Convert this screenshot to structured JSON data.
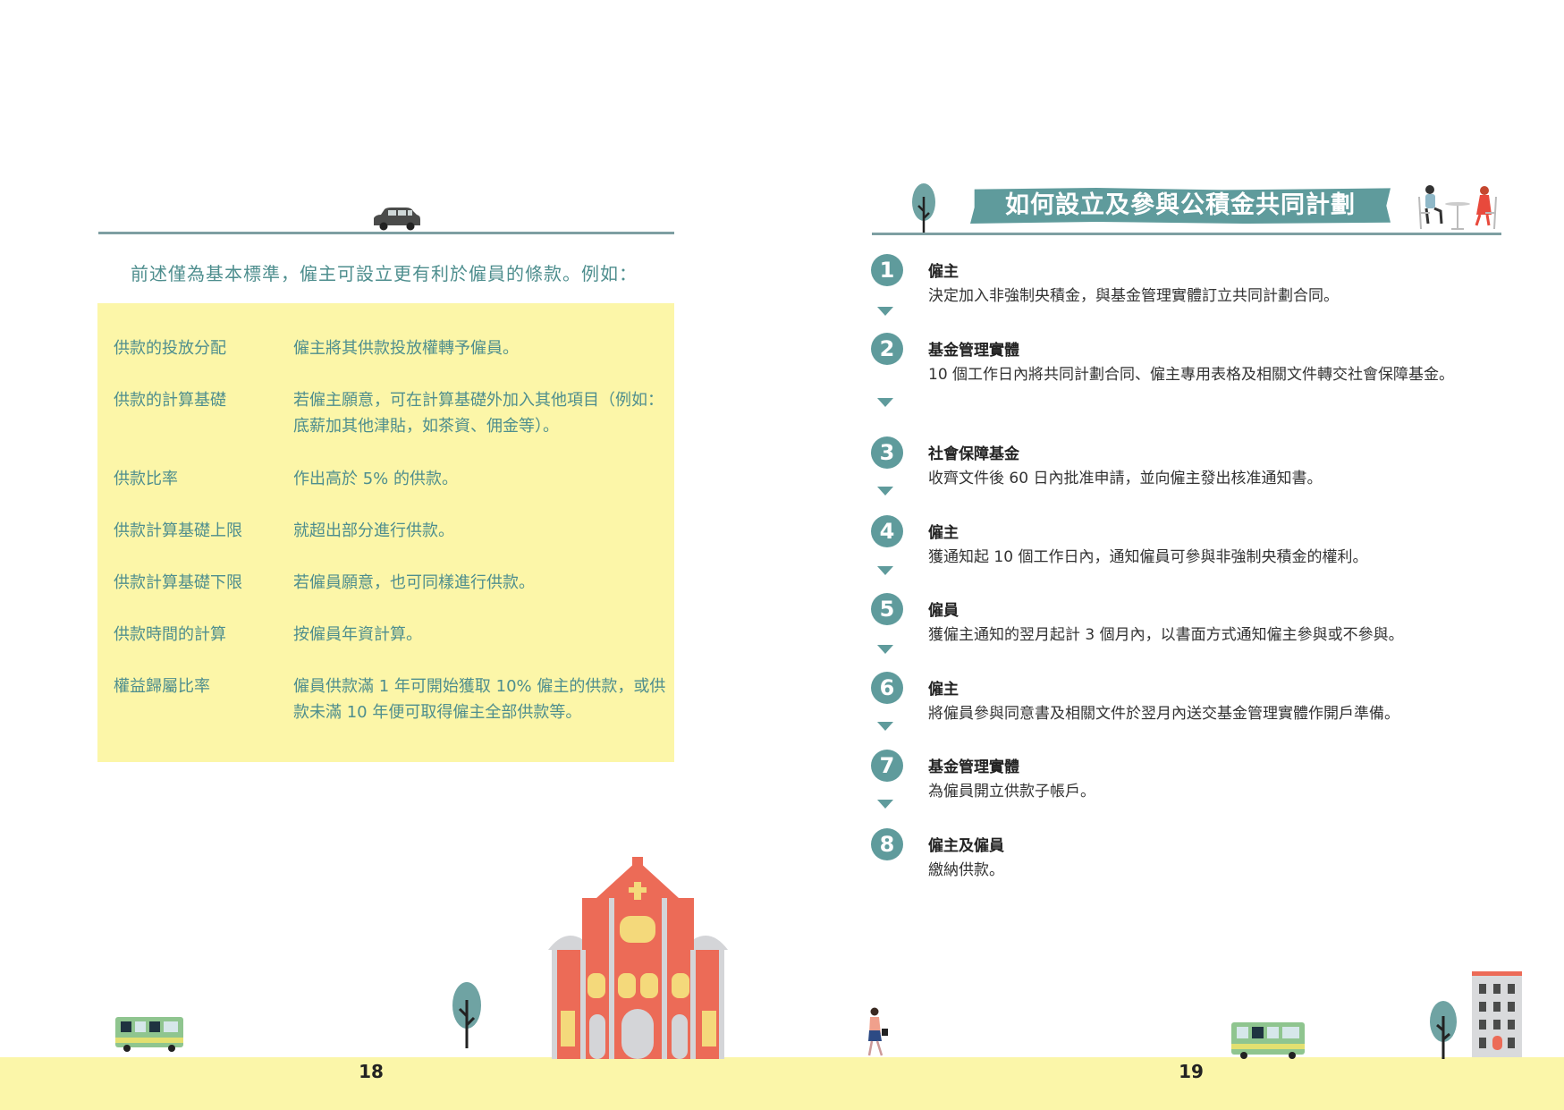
{
  "left_page": {
    "intro": "前述僅為基本標準，僱主可設立更有利於僱員的條款。例如：",
    "rows": [
      {
        "label": "供款的投放分配",
        "value": "僱主將其供款投放權轉予僱員。"
      },
      {
        "label": "供款的計算基礎",
        "value": "若僱主願意，可在計算基礎外加入其他項目（例如：底薪加其他津貼，如茶資、佣金等）。"
      },
      {
        "label": "供款比率",
        "value": "作出高於 5% 的供款。"
      },
      {
        "label": "供款計算基礎上限",
        "value": "就超出部分進行供款。"
      },
      {
        "label": "供款計算基礎下限",
        "value": "若僱員願意，也可同樣進行供款。"
      },
      {
        "label": "供款時間的計算",
        "value": "按僱員年資計算。"
      },
      {
        "label": "權益歸屬比率",
        "value": "僱員供款滿 1 年可開始獲取 10% 僱主的供款，或供款未滿 10 年便可取得僱主全部供款等。"
      }
    ],
    "page_number": "18"
  },
  "right_page": {
    "title": "如何設立及參與公積金共同計劃",
    "steps": [
      {
        "num": "1",
        "title": "僱主",
        "desc": "決定加入非強制央積金，與基金管理實體訂立共同計劃合同。"
      },
      {
        "num": "2",
        "title": "基金管理實體",
        "desc": "10 個工作日內將共同計劃合同、僱主專用表格及相關文件轉交社會保障基金。"
      },
      {
        "num": "3",
        "title": "社會保障基金",
        "desc": "收齊文件後 60 日內批准申請，並向僱主發出核准通知書。"
      },
      {
        "num": "4",
        "title": "僱主",
        "desc": "獲通知起 10 個工作日內，通知僱員可參與非強制央積金的權利。"
      },
      {
        "num": "5",
        "title": "僱員",
        "desc": "獲僱主通知的翌月起計 3 個月內，以書面方式通知僱主參與或不參與。"
      },
      {
        "num": "6",
        "title": "僱主",
        "desc": "將僱員參與同意書及相關文件於翌月內送交基金管理實體作開戶準備。"
      },
      {
        "num": "7",
        "title": "基金管理實體",
        "desc": "為僱員開立供款子帳戶。"
      },
      {
        "num": "8",
        "title": "僱主及僱員",
        "desc": "繳納供款。"
      }
    ],
    "page_number": "19"
  },
  "colors": {
    "teal": "#5f9b9c",
    "teal_text": "#4e8e8e",
    "pale_yellow": "#fcf6a8",
    "coral": "#ec6b57"
  },
  "icons": [
    "car-icon",
    "tree-icon",
    "bus-icon",
    "ruins-of-st-paul-icon",
    "walking-woman-icon",
    "cafe-couple-icon",
    "building-icon"
  ]
}
